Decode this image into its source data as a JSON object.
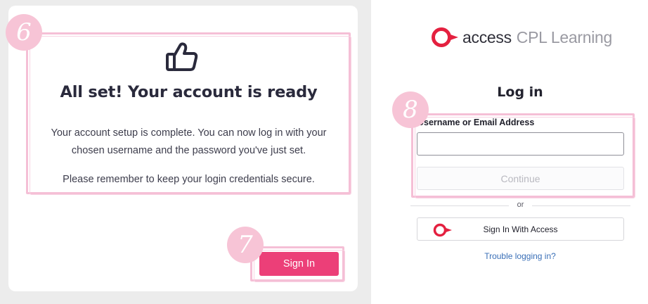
{
  "colors": {
    "accent_pink": "#ec3f78",
    "highlight_pink": "#f5bfd6",
    "brand_red": "#e4203f",
    "link_blue": "#3a6fb7"
  },
  "annotations": {
    "step6": "6",
    "step7": "7",
    "step8": "8"
  },
  "success_card": {
    "icon": "thumbs-up-icon",
    "title": "All set! Your account is ready",
    "message": "Your account setup is complete. You can now log in with your chosen username and the password you've just set.",
    "note": "Please remember to keep your login credentials secure.",
    "sign_in_label": "Sign In"
  },
  "login": {
    "brand_primary": "access",
    "brand_secondary": "CPL Learning",
    "title": "Log in",
    "username_label": "Username or Email Address",
    "username_value": "",
    "continue_label": "Continue",
    "divider_text": "or",
    "access_button_icon": "access-logo-icon",
    "access_button_label": "Sign In With Access",
    "trouble_link": "Trouble logging in?"
  }
}
